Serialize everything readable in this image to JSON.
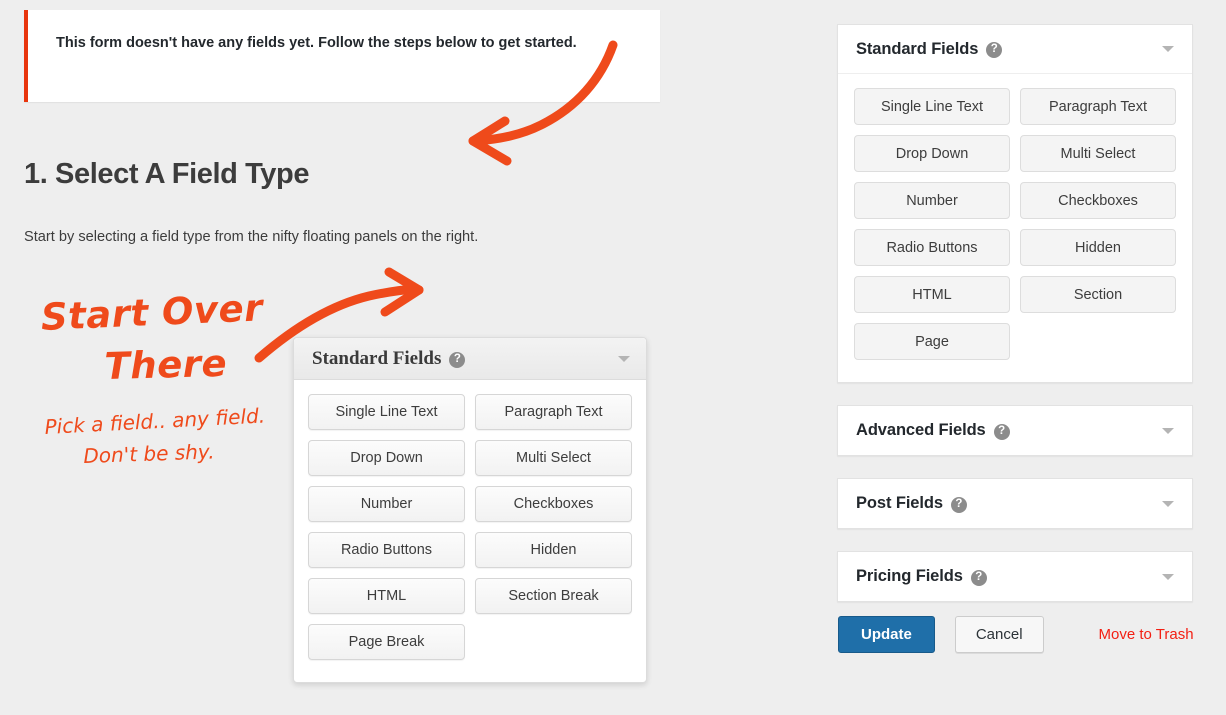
{
  "page": {
    "background_color": "#eeeeee",
    "accent_orange": "#ef4a1b",
    "notice_bar_color": "#e8350d",
    "primary_blue": "#1f6fa9",
    "danger_red": "#f31f13"
  },
  "notice": {
    "text": "This form doesn't have any fields yet. Follow the steps below to get started."
  },
  "step": {
    "heading": "1. Select A Field Type",
    "description": "Start by selecting a field type from the nifty floating panels on the right."
  },
  "annotations": {
    "start_over": "Start Over",
    "there": "There",
    "pick_line1": "Pick a field.. any field.",
    "pick_line2": "Don't be shy.",
    "arrow_to_notice": "curved-arrow-pointing-left",
    "arrow_to_panel": "curved-arrow-pointing-right"
  },
  "floating_panel": {
    "title": "Standard Fields",
    "help_glyph": "?",
    "fields": [
      "Single Line Text",
      "Paragraph Text",
      "Drop Down",
      "Multi Select",
      "Number",
      "Checkboxes",
      "Radio Buttons",
      "Hidden",
      "HTML",
      "Section Break",
      "Page Break"
    ]
  },
  "sidebar": {
    "panels": [
      {
        "title": "Standard Fields",
        "expanded": true,
        "fields": [
          "Single Line Text",
          "Paragraph Text",
          "Drop Down",
          "Multi Select",
          "Number",
          "Checkboxes",
          "Radio Buttons",
          "Hidden",
          "HTML",
          "Section",
          "Page"
        ]
      },
      {
        "title": "Advanced Fields",
        "expanded": false,
        "fields": []
      },
      {
        "title": "Post Fields",
        "expanded": false,
        "fields": []
      },
      {
        "title": "Pricing Fields",
        "expanded": false,
        "fields": []
      }
    ],
    "help_glyph": "?"
  },
  "actions": {
    "update_label": "Update",
    "cancel_label": "Cancel",
    "trash_label": "Move to Trash"
  }
}
